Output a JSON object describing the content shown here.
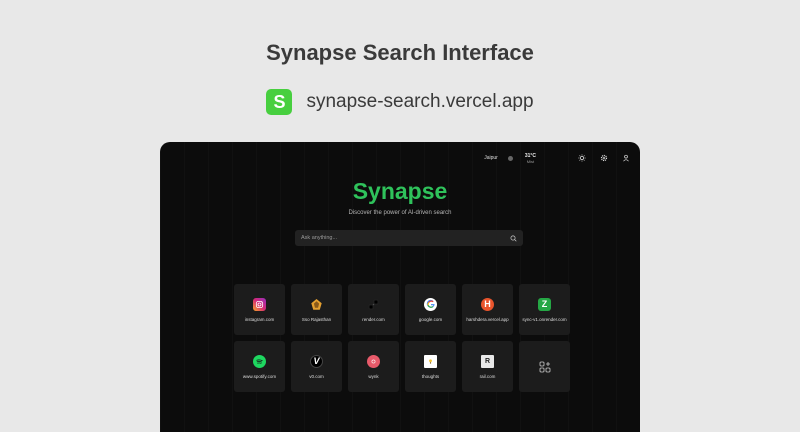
{
  "card": {
    "title": "Synapse Search Interface",
    "logo_letter": "S",
    "url": "synapse-search.vercel.app"
  },
  "topbar": {
    "city": "Jaipur",
    "temperature": "31°C",
    "condition": "Mist"
  },
  "hero": {
    "brand": "Synapse",
    "tagline": "Discover the power of AI-driven search",
    "search_placeholder": "Ask anything..."
  },
  "shortcuts": [
    {
      "label": "instagram.com",
      "icon": "instagram-icon",
      "letter": "",
      "color": "#d62976"
    },
    {
      "label": "Sso Rajasthan",
      "icon": "sso-rajasthan-icon",
      "letter": "",
      "color": "#e5a030"
    },
    {
      "label": "render.com",
      "icon": "render-icon",
      "letter": "",
      "color": "#000000"
    },
    {
      "label": "google.com",
      "icon": "google-icon",
      "letter": "G",
      "color": "#ffffff"
    },
    {
      "label": "harshdera.vercel.app",
      "icon": "harshdera-icon",
      "letter": "H",
      "color": "#e8542c"
    },
    {
      "label": "sync-v1.onrender.com",
      "icon": "sync-icon",
      "letter": "Z",
      "color": "#25a745"
    },
    {
      "label": "www.spotify.com",
      "icon": "spotify-icon",
      "letter": "",
      "color": "#1ed760"
    },
    {
      "label": "v0.com",
      "icon": "v0-icon",
      "letter": "V",
      "color": "#000000"
    },
    {
      "label": "wynk",
      "icon": "wynk-icon",
      "letter": "",
      "color": "#e85a6a"
    },
    {
      "label": "thoughts",
      "icon": "thoughts-icon",
      "letter": "",
      "color": "#ffffff"
    },
    {
      "label": "rail.com",
      "icon": "rail-icon",
      "letter": "R",
      "color": "#e8e8e8"
    }
  ],
  "add_shortcut_icon": "add-apps-icon"
}
